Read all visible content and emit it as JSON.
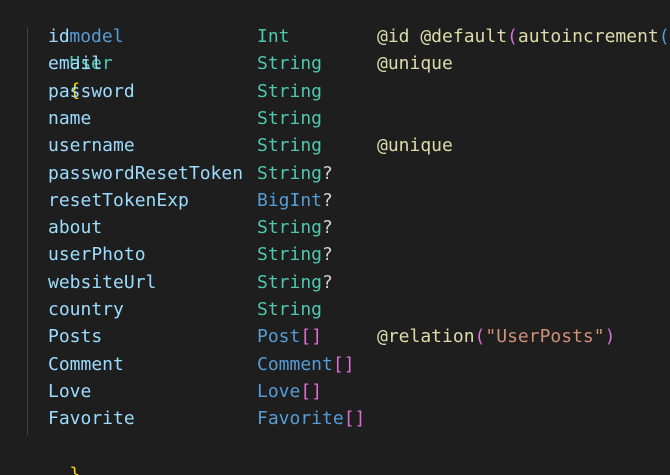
{
  "model": {
    "keyword": "model",
    "name": "User",
    "open_brace": "{",
    "close_brace": "}"
  },
  "fields": [
    {
      "name": "id",
      "type": "Int",
      "modifier": "",
      "attr_name": "@id @default",
      "attr_open": "(",
      "attr_arg": "autoincrement",
      "attr_close": "("
    },
    {
      "name": "email",
      "type": "String",
      "modifier": "",
      "attr_name": "@unique",
      "attr_open": "",
      "attr_arg": "",
      "attr_close": ""
    },
    {
      "name": "password",
      "type": "String",
      "modifier": "",
      "attr_name": "",
      "attr_open": "",
      "attr_arg": "",
      "attr_close": ""
    },
    {
      "name": "name",
      "type": "String",
      "modifier": "",
      "attr_name": "",
      "attr_open": "",
      "attr_arg": "",
      "attr_close": ""
    },
    {
      "name": "username",
      "type": "String",
      "modifier": "",
      "attr_name": "@unique",
      "attr_open": "",
      "attr_arg": "",
      "attr_close": ""
    },
    {
      "name": "passwordResetToken",
      "type": "String",
      "modifier": "?",
      "attr_name": "",
      "attr_open": "",
      "attr_arg": "",
      "attr_close": ""
    },
    {
      "name": "resetTokenExp",
      "type": "BigInt",
      "modifier": "?",
      "attr_name": "",
      "attr_open": "",
      "attr_arg": "",
      "attr_close": ""
    },
    {
      "name": "about",
      "type": "String",
      "modifier": "?",
      "attr_name": "",
      "attr_open": "",
      "attr_arg": "",
      "attr_close": ""
    },
    {
      "name": "userPhoto",
      "type": "String",
      "modifier": "?",
      "attr_name": "",
      "attr_open": "",
      "attr_arg": "",
      "attr_close": ""
    },
    {
      "name": "websiteUrl",
      "type": "String",
      "modifier": "?",
      "attr_name": "",
      "attr_open": "",
      "attr_arg": "",
      "attr_close": ""
    },
    {
      "name": "country",
      "type": "String",
      "modifier": "",
      "attr_name": "",
      "attr_open": "",
      "attr_arg": "",
      "attr_close": ""
    },
    {
      "name": "Posts",
      "type": "Post",
      "modifier": "[]",
      "attr_name": "@relation",
      "attr_open": "(",
      "attr_arg": "\"UserPosts\"",
      "attr_close": ")"
    },
    {
      "name": "Comment",
      "type": "Comment",
      "modifier": "[]",
      "attr_name": "",
      "attr_open": "",
      "attr_arg": "",
      "attr_close": ""
    },
    {
      "name": "Love",
      "type": "Love",
      "modifier": "[]",
      "attr_name": "",
      "attr_open": "",
      "attr_arg": "",
      "attr_close": ""
    },
    {
      "name": "Favorite",
      "type": "Favorite",
      "modifier": "[]",
      "attr_name": "",
      "attr_open": "",
      "attr_arg": "",
      "attr_close": ""
    }
  ],
  "colors": {
    "background": "#1e1e1e",
    "keyword": "#569cd6",
    "model_name": "#4ec9b0",
    "brace": "#ffd700",
    "field_name": "#9cdcfe",
    "scalar_type": "#4ec9b0",
    "relation_type": "#569cd6",
    "attribute": "#dcdcaa",
    "bracket": "#da70d6",
    "string": "#ce9178"
  }
}
